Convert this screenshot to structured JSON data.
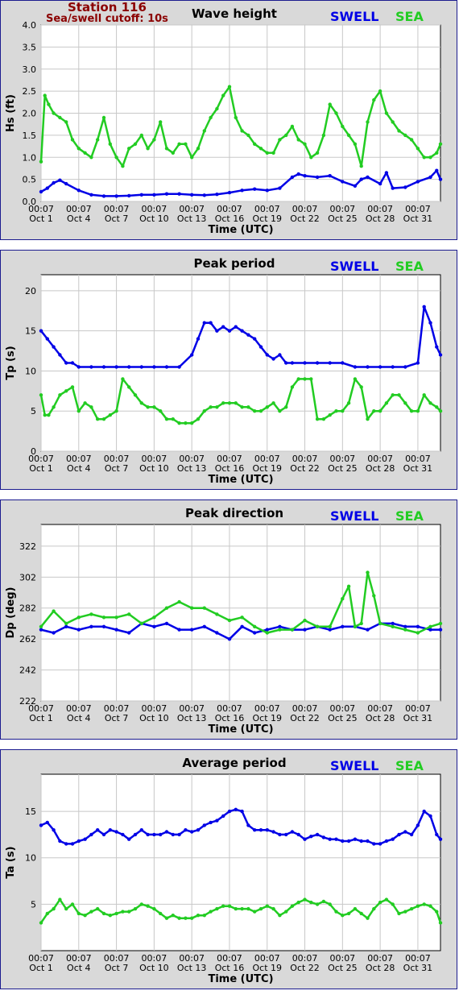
{
  "station": {
    "name": "Station 116",
    "cutoff": "Sea/swell cutoff: 10s"
  },
  "legend": {
    "swell": "SWELL",
    "sea": "SEA"
  },
  "colors": {
    "swell": "#0000e6",
    "sea": "#22cc22",
    "background": "#d9d9d9",
    "plot": "#ffffff",
    "grid": "#c8c8c8"
  },
  "x_ticks": [
    {
      "time": "00:07",
      "date": "Oct 1"
    },
    {
      "time": "00:07",
      "date": "Oct 4"
    },
    {
      "time": "00:07",
      "date": "Oct 7"
    },
    {
      "time": "00:07",
      "date": "Oct 10"
    },
    {
      "time": "00:07",
      "date": "Oct 13"
    },
    {
      "time": "00:07",
      "date": "Oct 16"
    },
    {
      "time": "00:07",
      "date": "Oct 19"
    },
    {
      "time": "00:07",
      "date": "Oct 22"
    },
    {
      "time": "00:07",
      "date": "Oct 25"
    },
    {
      "time": "00:07",
      "date": "Oct 28"
    },
    {
      "time": "00:07",
      "date": "Oct 31"
    }
  ],
  "chart_data": [
    {
      "type": "line",
      "title": "Wave height",
      "xlabel": "Time (UTC)",
      "ylabel": "Hs (ft)",
      "ylim": [
        0,
        4
      ],
      "yticks": [
        "0.0",
        "0.5",
        "1.0",
        "1.5",
        "2.0",
        "2.5",
        "3.0",
        "3.5",
        "4.0"
      ],
      "xlim_days": [
        1,
        32.8
      ],
      "series": [
        {
          "name": "SWELL",
          "x": [
            1,
            1.5,
            2,
            2.5,
            3,
            4,
            5,
            6,
            7,
            8,
            9,
            10,
            11,
            12,
            13,
            14,
            15,
            16,
            17,
            18,
            19,
            20,
            21,
            21.5,
            22,
            23,
            24,
            25,
            26,
            26.5,
            27,
            28,
            28.5,
            29,
            30,
            31,
            32,
            32.5,
            32.8
          ],
          "y": [
            0.22,
            0.3,
            0.42,
            0.48,
            0.4,
            0.25,
            0.15,
            0.12,
            0.12,
            0.13,
            0.15,
            0.15,
            0.17,
            0.17,
            0.15,
            0.14,
            0.16,
            0.2,
            0.25,
            0.28,
            0.25,
            0.3,
            0.55,
            0.62,
            0.58,
            0.55,
            0.58,
            0.45,
            0.35,
            0.5,
            0.55,
            0.4,
            0.65,
            0.3,
            0.32,
            0.45,
            0.55,
            0.7,
            0.5
          ]
        },
        {
          "name": "SEA",
          "x": [
            1,
            1.3,
            1.6,
            2,
            2.5,
            3,
            3.5,
            4,
            4.5,
            5,
            5.5,
            6,
            6.5,
            7,
            7.5,
            8,
            8.5,
            9,
            9.5,
            10,
            10.5,
            11,
            11.5,
            12,
            12.5,
            13,
            13.5,
            14,
            14.5,
            15,
            15.5,
            16,
            16.5,
            17,
            17.5,
            18,
            18.5,
            19,
            19.5,
            20,
            20.5,
            21,
            21.5,
            22,
            22.5,
            23,
            23.5,
            24,
            24.5,
            25,
            25.5,
            26,
            26.5,
            27,
            27.5,
            28,
            28.5,
            29,
            29.5,
            30,
            30.5,
            31,
            31.5,
            32,
            32.5,
            32.8
          ],
          "y": [
            0.9,
            2.4,
            2.2,
            2.0,
            1.9,
            1.8,
            1.4,
            1.2,
            1.1,
            1.0,
            1.4,
            1.9,
            1.3,
            1.0,
            0.8,
            1.2,
            1.3,
            1.5,
            1.2,
            1.4,
            1.8,
            1.2,
            1.1,
            1.3,
            1.3,
            1.0,
            1.2,
            1.6,
            1.9,
            2.1,
            2.4,
            2.6,
            1.9,
            1.6,
            1.5,
            1.3,
            1.2,
            1.1,
            1.1,
            1.4,
            1.5,
            1.7,
            1.4,
            1.3,
            1.0,
            1.1,
            1.5,
            2.2,
            2.0,
            1.7,
            1.5,
            1.3,
            0.8,
            1.8,
            2.3,
            2.5,
            2.0,
            1.8,
            1.6,
            1.5,
            1.4,
            1.2,
            1.0,
            1.0,
            1.1,
            1.3
          ]
        }
      ]
    },
    {
      "type": "line",
      "title": "Peak period",
      "xlabel": "Time (UTC)",
      "ylabel": "Tp (s)",
      "ylim": [
        0,
        22
      ],
      "yticks": [
        "0",
        "5",
        "10",
        "15",
        "20"
      ],
      "xlim_days": [
        1,
        32.8
      ],
      "series": [
        {
          "name": "SWELL",
          "x": [
            1,
            1.5,
            2,
            2.5,
            3,
            3.5,
            4,
            5,
            6,
            7,
            8,
            9,
            10,
            11,
            12,
            13,
            13.5,
            14,
            14.5,
            15,
            15.5,
            16,
            16.5,
            17,
            17.5,
            18,
            18.5,
            19,
            19.5,
            20,
            20.5,
            21,
            22,
            23,
            24,
            25,
            26,
            27,
            28,
            29,
            30,
            31,
            31.5,
            32,
            32.5,
            32.8
          ],
          "y": [
            15,
            14,
            13,
            12,
            11,
            11,
            10.5,
            10.5,
            10.5,
            10.5,
            10.5,
            10.5,
            10.5,
            10.5,
            10.5,
            12,
            14,
            16,
            16,
            15,
            15.5,
            15,
            15.5,
            15,
            14.5,
            14,
            13,
            12,
            11.5,
            12,
            11,
            11,
            11,
            11,
            11,
            11,
            10.5,
            10.5,
            10.5,
            10.5,
            10.5,
            11,
            18,
            16,
            13,
            12
          ]
        },
        {
          "name": "SEA",
          "x": [
            1,
            1.3,
            1.6,
            2,
            2.5,
            3,
            3.5,
            4,
            4.5,
            5,
            5.5,
            6,
            6.5,
            7,
            7.5,
            8,
            8.5,
            9,
            9.5,
            10,
            10.5,
            11,
            11.5,
            12,
            12.5,
            13,
            13.5,
            14,
            14.5,
            15,
            15.5,
            16,
            16.5,
            17,
            17.5,
            18,
            18.5,
            19,
            19.5,
            20,
            20.5,
            21,
            21.5,
            22,
            22.5,
            23,
            23.5,
            24,
            24.5,
            25,
            25.5,
            26,
            26.5,
            27,
            27.5,
            28,
            28.5,
            29,
            29.5,
            30,
            30.5,
            31,
            31.5,
            32,
            32.5,
            32.8
          ],
          "y": [
            7,
            4.5,
            4.5,
            5.5,
            7,
            7.5,
            8,
            5,
            6,
            5.5,
            4,
            4,
            4.5,
            5,
            9,
            8,
            7,
            6,
            5.5,
            5.5,
            5,
            4,
            4,
            3.5,
            3.5,
            3.5,
            4,
            5,
            5.5,
            5.5,
            6,
            6,
            6,
            5.5,
            5.5,
            5,
            5,
            5.5,
            6,
            5,
            5.5,
            8,
            9,
            9,
            9,
            4,
            4,
            4.5,
            5,
            5,
            6,
            9,
            8,
            4,
            5,
            5,
            6,
            7,
            7,
            6,
            5,
            5,
            7,
            6,
            5.5,
            5
          ]
        }
      ]
    },
    {
      "type": "line",
      "title": "Peak direction",
      "xlabel": "Time (UTC)",
      "ylabel": "Dp (deg)",
      "ylim": [
        222,
        336
      ],
      "yticks": [
        "222",
        "242",
        "262",
        "282",
        "302",
        "322"
      ],
      "xlim_days": [
        1,
        32.8
      ],
      "series": [
        {
          "name": "SWELL",
          "x": [
            1,
            2,
            3,
            4,
            5,
            6,
            7,
            8,
            9,
            10,
            11,
            12,
            13,
            14,
            15,
            16,
            17,
            18,
            19,
            20,
            21,
            22,
            23,
            24,
            25,
            26,
            27,
            28,
            29,
            30,
            31,
            32,
            32.8
          ],
          "y": [
            268,
            266,
            270,
            268,
            270,
            270,
            268,
            266,
            272,
            270,
            272,
            268,
            268,
            270,
            266,
            262,
            270,
            266,
            268,
            270,
            268,
            268,
            270,
            268,
            270,
            270,
            268,
            272,
            272,
            270,
            270,
            268,
            268
          ]
        },
        {
          "name": "SEA",
          "x": [
            1,
            2,
            3,
            4,
            5,
            6,
            7,
            8,
            9,
            10,
            11,
            12,
            13,
            14,
            15,
            16,
            17,
            18,
            19,
            20,
            21,
            22,
            23,
            24,
            25,
            25.5,
            26,
            26.5,
            27,
            27.5,
            28,
            29,
            30,
            31,
            32,
            32.8
          ],
          "y": [
            270,
            280,
            272,
            276,
            278,
            276,
            276,
            278,
            272,
            276,
            282,
            286,
            282,
            282,
            278,
            274,
            276,
            270,
            266,
            268,
            268,
            274,
            270,
            270,
            288,
            296,
            270,
            272,
            305,
            290,
            272,
            270,
            268,
            266,
            270,
            272
          ]
        }
      ]
    },
    {
      "type": "line",
      "title": "Average period",
      "xlabel": "Time (UTC)",
      "ylabel": "Ta (s)",
      "ylim": [
        0,
        19
      ],
      "yticks": [
        "5",
        "10",
        "15"
      ],
      "xlim_days": [
        1,
        32.8
      ],
      "series": [
        {
          "name": "SWELL",
          "x": [
            1,
            1.5,
            2,
            2.5,
            3,
            3.5,
            4,
            4.5,
            5,
            5.5,
            6,
            6.5,
            7,
            7.5,
            8,
            8.5,
            9,
            9.5,
            10,
            10.5,
            11,
            11.5,
            12,
            12.5,
            13,
            13.5,
            14,
            14.5,
            15,
            15.5,
            16,
            16.5,
            17,
            17.5,
            18,
            18.5,
            19,
            19.5,
            20,
            20.5,
            21,
            21.5,
            22,
            22.5,
            23,
            23.5,
            24,
            24.5,
            25,
            25.5,
            26,
            26.5,
            27,
            27.5,
            28,
            28.5,
            29,
            29.5,
            30,
            30.5,
            31,
            31.5,
            32,
            32.5,
            32.8
          ],
          "y": [
            13.5,
            13.8,
            13,
            11.8,
            11.5,
            11.5,
            11.8,
            12,
            12.5,
            13,
            12.5,
            13,
            12.8,
            12.5,
            12,
            12.5,
            13,
            12.5,
            12.5,
            12.5,
            12.8,
            12.5,
            12.5,
            13,
            12.8,
            13,
            13.5,
            13.8,
            14,
            14.5,
            15,
            15.2,
            15,
            13.5,
            13,
            13,
            13,
            12.8,
            12.5,
            12.5,
            12.8,
            12.5,
            12,
            12.3,
            12.5,
            12.2,
            12,
            12,
            11.8,
            11.8,
            12,
            11.8,
            11.8,
            11.5,
            11.5,
            11.8,
            12,
            12.5,
            12.8,
            12.5,
            13.5,
            15,
            14.5,
            12.5,
            12
          ]
        },
        {
          "name": "SEA",
          "x": [
            1,
            1.5,
            2,
            2.5,
            3,
            3.5,
            4,
            4.5,
            5,
            5.5,
            6,
            6.5,
            7,
            7.5,
            8,
            8.5,
            9,
            9.5,
            10,
            10.5,
            11,
            11.5,
            12,
            12.5,
            13,
            13.5,
            14,
            14.5,
            15,
            15.5,
            16,
            16.5,
            17,
            17.5,
            18,
            18.5,
            19,
            19.5,
            20,
            20.5,
            21,
            21.5,
            22,
            22.5,
            23,
            23.5,
            24,
            24.5,
            25,
            25.5,
            26,
            26.5,
            27,
            27.5,
            28,
            28.5,
            29,
            29.5,
            30,
            30.5,
            31,
            31.5,
            32,
            32.5,
            32.8
          ],
          "y": [
            3,
            4,
            4.5,
            5.5,
            4.5,
            5,
            4,
            3.8,
            4.2,
            4.5,
            4,
            3.8,
            4,
            4.2,
            4.2,
            4.5,
            5,
            4.8,
            4.5,
            4,
            3.5,
            3.8,
            3.5,
            3.5,
            3.5,
            3.8,
            3.8,
            4.2,
            4.5,
            4.8,
            4.8,
            4.5,
            4.5,
            4.5,
            4.2,
            4.5,
            4.8,
            4.5,
            3.8,
            4.2,
            4.8,
            5.2,
            5.5,
            5.2,
            5,
            5.3,
            5,
            4.2,
            3.8,
            4,
            4.5,
            4,
            3.5,
            4.5,
            5.2,
            5.5,
            5,
            4,
            4.2,
            4.5,
            4.8,
            5,
            4.8,
            4.2,
            3
          ]
        }
      ]
    }
  ]
}
